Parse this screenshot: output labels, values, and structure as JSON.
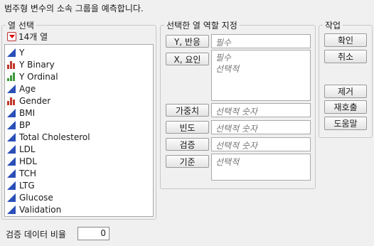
{
  "dialog": {
    "description": "범주형 변수의 소속 그룹을 예측합니다."
  },
  "select_columns": {
    "legend": "열 선택",
    "count_label": "14개 열",
    "columns": [
      {
        "label": "Y",
        "icon": "continuous-icon"
      },
      {
        "label": "Y Binary",
        "icon": "nominal-icon"
      },
      {
        "label": "Y Ordinal",
        "icon": "ordinal-icon"
      },
      {
        "label": "Age",
        "icon": "continuous-icon"
      },
      {
        "label": "Gender",
        "icon": "nominal-icon"
      },
      {
        "label": "BMI",
        "icon": "continuous-icon"
      },
      {
        "label": "BP",
        "icon": "continuous-icon"
      },
      {
        "label": "Total Cholesterol",
        "icon": "continuous-icon"
      },
      {
        "label": "LDL",
        "icon": "continuous-icon"
      },
      {
        "label": "HDL",
        "icon": "continuous-icon"
      },
      {
        "label": "TCH",
        "icon": "continuous-icon"
      },
      {
        "label": "LTG",
        "icon": "continuous-icon"
      },
      {
        "label": "Glucose",
        "icon": "continuous-icon"
      },
      {
        "label": "Validation",
        "icon": "continuous-icon"
      }
    ]
  },
  "roles": {
    "legend": "선택한 열 역할 지정",
    "y_response": {
      "button": "Y, 반응",
      "hint": "필수"
    },
    "x_factor": {
      "button": "X, 요인",
      "hint_required": "필수",
      "hint_optional": "선택적"
    },
    "weight": {
      "button": "가중치",
      "hint": "선택적 숫자"
    },
    "freq": {
      "button": "빈도",
      "hint": "선택적 숫자"
    },
    "validation": {
      "button": "검증",
      "hint": "선택적 숫자"
    },
    "by": {
      "button": "기준",
      "hint": "선택적"
    }
  },
  "actions": {
    "legend": "작업",
    "ok": "확인",
    "cancel": "취소",
    "remove": "제거",
    "recall": "재호출",
    "help": "도움말"
  },
  "validation_ratio": {
    "label": "검증 데이터 비율",
    "value": "0"
  },
  "colors": {
    "continuous": "#2a4fb8",
    "nominal": "#c0392b",
    "ordinal": "#3c9a3c",
    "accent_red": "#d00000"
  }
}
